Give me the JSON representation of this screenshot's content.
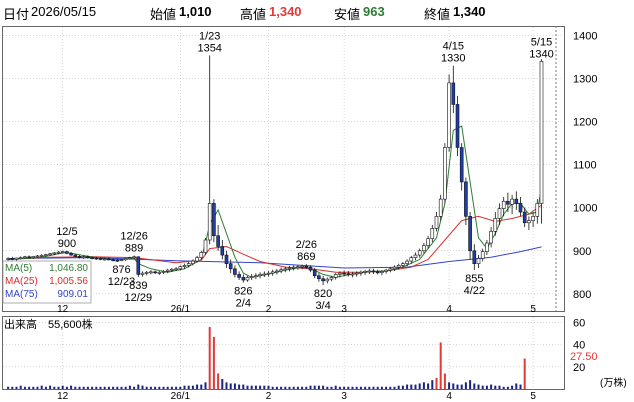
{
  "header": {
    "date_label": "日付",
    "date_value": "2026/05/15",
    "open_label": "始値",
    "open_value": "1,010",
    "high_label": "高値",
    "high_value": "1,340",
    "low_label": "安値",
    "low_value": "963",
    "close_label": "終値",
    "close_value": "1,340"
  },
  "colors": {
    "up": "#ffffff",
    "down": "#1f3ea8",
    "ma5": "#2e7d32",
    "ma25": "#d32f2f",
    "ma75": "#3344cc",
    "volume": "#1a237e",
    "volume_spike": "#e53935",
    "grid": "#b0b0b0"
  },
  "legend": {
    "ma5_label": "MA(5)",
    "ma5_value": "1,046.80",
    "ma25_label": "MA(25)",
    "ma25_value": "1,005.56",
    "ma75_label": "MA(75)",
    "ma75_value": "909.01"
  },
  "volume_panel": {
    "title": "出来高",
    "value": "55,600株",
    "unit": "(万株)",
    "current_value": "27.50"
  },
  "chart_data": [
    {
      "type": "candlestick",
      "y_ticks": [
        800,
        900,
        1000,
        1100,
        1200,
        1300,
        1400
      ],
      "ylim": [
        760,
        1420
      ],
      "x_ticks": [
        "12",
        "26/1",
        "2",
        "3",
        "4",
        "5"
      ],
      "annotations": [
        {
          "text": "12/5\n900",
          "value": 900,
          "index": 14,
          "pos": "above"
        },
        {
          "text": "876\n12/23",
          "value": 876,
          "index": 27,
          "pos": "below"
        },
        {
          "text": "12/26\n889",
          "value": 889,
          "index": 30,
          "pos": "above"
        },
        {
          "text": "839\n12/29",
          "value": 839,
          "index": 31,
          "pos": "below"
        },
        {
          "text": "1/23\n1354",
          "value": 1354,
          "index": 48,
          "pos": "above"
        },
        {
          "text": "826\n2/4",
          "value": 826,
          "index": 56,
          "pos": "below"
        },
        {
          "text": "2/26\n869",
          "value": 869,
          "index": 71,
          "pos": "above"
        },
        {
          "text": "820\n3/4",
          "value": 820,
          "index": 75,
          "pos": "below"
        },
        {
          "text": "4/15\n1330",
          "value": 1330,
          "index": 106,
          "pos": "above"
        },
        {
          "text": "855\n4/22",
          "value": 855,
          "index": 111,
          "pos": "below"
        },
        {
          "text": "5/15\n1340",
          "value": 1340,
          "index": 127,
          "pos": "above"
        }
      ],
      "candles": [
        [
          880,
          885,
          876,
          882
        ],
        [
          882,
          886,
          878,
          880
        ],
        [
          880,
          884,
          877,
          883
        ],
        [
          883,
          887,
          880,
          884
        ],
        [
          884,
          888,
          881,
          886
        ],
        [
          886,
          889,
          882,
          884
        ],
        [
          884,
          888,
          881,
          887
        ],
        [
          887,
          890,
          884,
          888
        ],
        [
          888,
          892,
          885,
          889
        ],
        [
          889,
          893,
          886,
          891
        ],
        [
          891,
          895,
          888,
          893
        ],
        [
          893,
          897,
          890,
          895
        ],
        [
          895,
          899,
          892,
          897
        ],
        [
          897,
          900,
          894,
          898
        ],
        [
          898,
          900,
          892,
          894
        ],
        [
          894,
          897,
          888,
          890
        ],
        [
          890,
          893,
          885,
          887
        ],
        [
          887,
          890,
          882,
          885
        ],
        [
          885,
          889,
          881,
          886
        ],
        [
          886,
          889,
          882,
          884
        ],
        [
          884,
          887,
          880,
          883
        ],
        [
          883,
          886,
          879,
          882
        ],
        [
          882,
          885,
          878,
          880
        ],
        [
          880,
          884,
          877,
          881
        ],
        [
          881,
          884,
          878,
          879
        ],
        [
          879,
          882,
          876,
          878
        ],
        [
          878,
          881,
          874,
          877
        ],
        [
          877,
          880,
          876,
          879
        ],
        [
          879,
          884,
          876,
          882
        ],
        [
          882,
          886,
          879,
          884
        ],
        [
          884,
          889,
          880,
          886
        ],
        [
          886,
          887,
          839,
          845
        ],
        [
          845,
          852,
          840,
          848
        ],
        [
          848,
          853,
          843,
          850
        ],
        [
          850,
          855,
          845,
          851
        ],
        [
          851,
          854,
          846,
          849
        ],
        [
          849,
          853,
          844,
          850
        ],
        [
          850,
          855,
          846,
          852
        ],
        [
          852,
          858,
          848,
          855
        ],
        [
          855,
          860,
          851,
          857
        ],
        [
          857,
          862,
          853,
          858
        ],
        [
          858,
          866,
          854,
          863
        ],
        [
          863,
          870,
          858,
          866
        ],
        [
          866,
          874,
          861,
          870
        ],
        [
          870,
          880,
          866,
          876
        ],
        [
          876,
          888,
          872,
          884
        ],
        [
          884,
          900,
          880,
          896
        ],
        [
          896,
          930,
          890,
          925
        ],
        [
          925,
          1354,
          915,
          1010
        ],
        [
          1010,
          1020,
          920,
          935
        ],
        [
          935,
          960,
          900,
          910
        ],
        [
          910,
          925,
          880,
          890
        ],
        [
          890,
          900,
          860,
          870
        ],
        [
          870,
          880,
          848,
          858
        ],
        [
          858,
          866,
          838,
          845
        ],
        [
          845,
          852,
          832,
          838
        ],
        [
          838,
          845,
          826,
          832
        ],
        [
          832,
          842,
          828,
          838
        ],
        [
          838,
          846,
          832,
          840
        ],
        [
          840,
          848,
          834,
          842
        ],
        [
          842,
          850,
          836,
          845
        ],
        [
          845,
          852,
          839,
          846
        ],
        [
          846,
          853,
          840,
          848
        ],
        [
          848,
          856,
          842,
          851
        ],
        [
          851,
          858,
          845,
          853
        ],
        [
          853,
          861,
          848,
          856
        ],
        [
          856,
          863,
          850,
          858
        ],
        [
          858,
          865,
          852,
          860
        ],
        [
          860,
          866,
          854,
          862
        ],
        [
          862,
          867,
          856,
          863
        ],
        [
          863,
          868,
          857,
          864
        ],
        [
          864,
          869,
          858,
          862
        ],
        [
          862,
          866,
          850,
          855
        ],
        [
          855,
          860,
          836,
          842
        ],
        [
          842,
          848,
          828,
          835
        ],
        [
          835,
          842,
          820,
          830
        ],
        [
          830,
          838,
          824,
          834
        ],
        [
          834,
          842,
          829,
          838
        ],
        [
          838,
          848,
          833,
          845
        ],
        [
          845,
          852,
          838,
          848
        ],
        [
          848,
          854,
          841,
          847
        ],
        [
          847,
          853,
          840,
          845
        ],
        [
          845,
          851,
          838,
          846
        ],
        [
          846,
          852,
          840,
          848
        ],
        [
          848,
          854,
          842,
          850
        ],
        [
          850,
          856,
          844,
          852
        ],
        [
          852,
          858,
          846,
          853
        ],
        [
          853,
          858,
          846,
          851
        ],
        [
          851,
          856,
          845,
          849
        ],
        [
          849,
          855,
          843,
          852
        ],
        [
          852,
          858,
          847,
          855
        ],
        [
          855,
          862,
          850,
          858
        ],
        [
          858,
          866,
          853,
          862
        ],
        [
          862,
          870,
          857,
          866
        ],
        [
          866,
          874,
          860,
          870
        ],
        [
          870,
          880,
          864,
          876
        ],
        [
          876,
          888,
          870,
          884
        ],
        [
          884,
          896,
          878,
          890
        ],
        [
          890,
          905,
          884,
          900
        ],
        [
          900,
          918,
          893,
          912
        ],
        [
          912,
          935,
          905,
          928
        ],
        [
          928,
          960,
          920,
          952
        ],
        [
          952,
          990,
          945,
          980
        ],
        [
          980,
          1030,
          970,
          1020
        ],
        [
          1020,
          1150,
          1010,
          1140
        ],
        [
          1140,
          1310,
          1130,
          1290
        ],
        [
          1290,
          1330,
          1220,
          1240
        ],
        [
          1240,
          1260,
          1120,
          1140
        ],
        [
          1140,
          1150,
          1040,
          1060
        ],
        [
          1060,
          1070,
          960,
          980
        ],
        [
          980,
          990,
          880,
          900
        ],
        [
          900,
          915,
          855,
          870
        ],
        [
          870,
          890,
          860,
          882
        ],
        [
          882,
          905,
          875,
          898
        ],
        [
          898,
          925,
          890,
          918
        ],
        [
          918,
          955,
          908,
          945
        ],
        [
          945,
          990,
          935,
          975
        ],
        [
          975,
          1010,
          960,
          998
        ],
        [
          998,
          1025,
          980,
          1015
        ],
        [
          1015,
          1035,
          990,
          1008
        ],
        [
          1008,
          1030,
          985,
          1020
        ],
        [
          1020,
          1038,
          995,
          1010
        ],
        [
          1010,
          1025,
          980,
          990
        ],
        [
          990,
          1000,
          955,
          965
        ],
        [
          965,
          980,
          948,
          970
        ],
        [
          970,
          990,
          955,
          980
        ],
        [
          980,
          1020,
          963,
          1010
        ],
        [
          1010,
          1345,
          963,
          1340
        ]
      ],
      "ma5": [
        [
          0,
          880
        ],
        [
          4,
          882
        ],
        [
          8,
          885
        ],
        [
          12,
          893
        ],
        [
          14,
          896
        ],
        [
          18,
          889
        ],
        [
          22,
          882
        ],
        [
          26,
          879
        ],
        [
          30,
          882
        ],
        [
          31,
          870
        ],
        [
          34,
          858
        ],
        [
          38,
          850
        ],
        [
          42,
          858
        ],
        [
          46,
          880
        ],
        [
          48,
          960
        ],
        [
          50,
          995
        ],
        [
          52,
          940
        ],
        [
          54,
          885
        ],
        [
          56,
          848
        ],
        [
          58,
          838
        ],
        [
          62,
          846
        ],
        [
          66,
          855
        ],
        [
          70,
          862
        ],
        [
          72,
          859
        ],
        [
          75,
          845
        ],
        [
          78,
          838
        ],
        [
          82,
          846
        ],
        [
          86,
          852
        ],
        [
          90,
          853
        ],
        [
          94,
          862
        ],
        [
          98,
          880
        ],
        [
          102,
          930
        ],
        [
          104,
          1010
        ],
        [
          106,
          1180
        ],
        [
          108,
          1190
        ],
        [
          110,
          1060
        ],
        [
          112,
          930
        ],
        [
          114,
          905
        ],
        [
          116,
          940
        ],
        [
          118,
          985
        ],
        [
          120,
          1010
        ],
        [
          122,
          1010
        ],
        [
          124,
          985
        ],
        [
          126,
          990
        ],
        [
          127,
          1047
        ]
      ],
      "ma25": [
        [
          0,
          880
        ],
        [
          10,
          885
        ],
        [
          20,
          886
        ],
        [
          30,
          884
        ],
        [
          40,
          872
        ],
        [
          46,
          878
        ],
        [
          48,
          905
        ],
        [
          52,
          910
        ],
        [
          56,
          892
        ],
        [
          60,
          875
        ],
        [
          66,
          862
        ],
        [
          72,
          858
        ],
        [
          78,
          850
        ],
        [
          84,
          850
        ],
        [
          90,
          853
        ],
        [
          96,
          862
        ],
        [
          100,
          880
        ],
        [
          104,
          925
        ],
        [
          108,
          970
        ],
        [
          112,
          980
        ],
        [
          116,
          968
        ],
        [
          120,
          975
        ],
        [
          124,
          985
        ],
        [
          127,
          1006
        ]
      ],
      "ma75": [
        [
          0,
          882
        ],
        [
          20,
          884
        ],
        [
          40,
          877
        ],
        [
          60,
          872
        ],
        [
          80,
          860
        ],
        [
          95,
          862
        ],
        [
          105,
          875
        ],
        [
          115,
          885
        ],
        [
          122,
          898
        ],
        [
          127,
          909
        ]
      ]
    },
    {
      "type": "bar",
      "title": "出来高",
      "unit": "(万株)",
      "y_ticks": [
        20,
        40,
        60
      ],
      "ylim": [
        0,
        65
      ],
      "spike_threshold": 10,
      "values": [
        2,
        2,
        2,
        3,
        2,
        2,
        2,
        2,
        3,
        2,
        3,
        2,
        2,
        3,
        2,
        3,
        2,
        2,
        2,
        2,
        2,
        2,
        2,
        2,
        2,
        2,
        2,
        2,
        2,
        3,
        2,
        4,
        3,
        2,
        2,
        2,
        2,
        2,
        2,
        2,
        2,
        2,
        3,
        3,
        3,
        4,
        4,
        6,
        56,
        47,
        14,
        9,
        6,
        5,
        5,
        4,
        4,
        3,
        3,
        3,
        3,
        3,
        3,
        2,
        2,
        2,
        2,
        2,
        2,
        2,
        2,
        2,
        3,
        3,
        3,
        3,
        2,
        2,
        3,
        2,
        2,
        2,
        2,
        2,
        2,
        2,
        2,
        2,
        2,
        2,
        2,
        2,
        2,
        3,
        3,
        4,
        4,
        4,
        5,
        6,
        5,
        8,
        10,
        42,
        14,
        6,
        5,
        4,
        4,
        6,
        8,
        5,
        4,
        3,
        3,
        4,
        3,
        3,
        2,
        2,
        3,
        5,
        4,
        27.5
      ]
    }
  ]
}
